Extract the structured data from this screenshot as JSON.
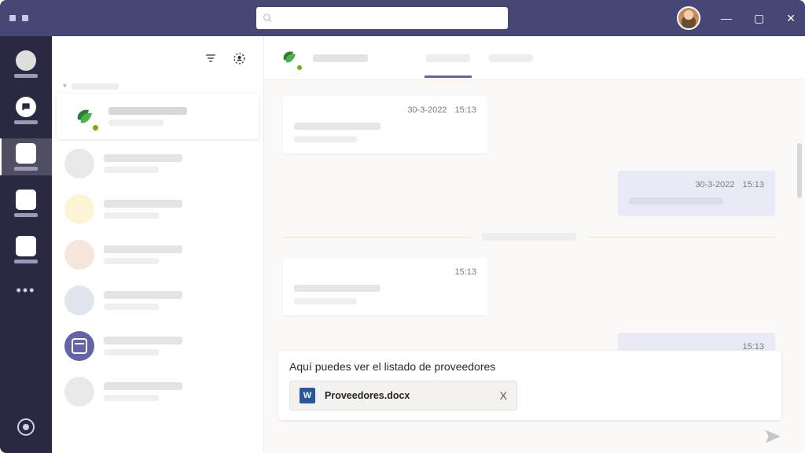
{
  "titlebar": {
    "search_placeholder": "",
    "window_controls": {
      "min": "—",
      "max": "▢",
      "close": "✕"
    }
  },
  "rail": {
    "items": [
      {
        "key": "activity"
      },
      {
        "key": "chat",
        "selected_hint": false
      },
      {
        "key": "teams",
        "selected": true
      },
      {
        "key": "assignments"
      },
      {
        "key": "calendar2"
      }
    ],
    "more": "•••"
  },
  "chatlist": {
    "section_label": "",
    "items": [
      {
        "id": "c0",
        "kind": "leaf",
        "selected": true
      },
      {
        "id": "c1",
        "kind": "grey"
      },
      {
        "id": "c2",
        "kind": "yellow"
      },
      {
        "id": "c3",
        "kind": "peach"
      },
      {
        "id": "c4",
        "kind": "bluegrey"
      },
      {
        "id": "c5",
        "kind": "cal"
      },
      {
        "id": "c6",
        "kind": "grey"
      }
    ]
  },
  "conversation": {
    "tabs": [
      {
        "id": "t0",
        "active": true
      },
      {
        "id": "t1",
        "active": false
      }
    ],
    "messages": [
      {
        "side": "other",
        "date": "30-3-2022",
        "time": "15:13"
      },
      {
        "side": "me",
        "date": "30-3-2022",
        "time": "15:13"
      },
      {
        "divider": true
      },
      {
        "side": "other",
        "date": "",
        "time": "15:13"
      },
      {
        "side": "me",
        "date": "",
        "time": "15:13"
      }
    ]
  },
  "composer": {
    "text": "Aquí puedes ver el listado de proveedores",
    "attachment": {
      "filename": "Proveedores.docx",
      "remove_label": "X"
    }
  }
}
